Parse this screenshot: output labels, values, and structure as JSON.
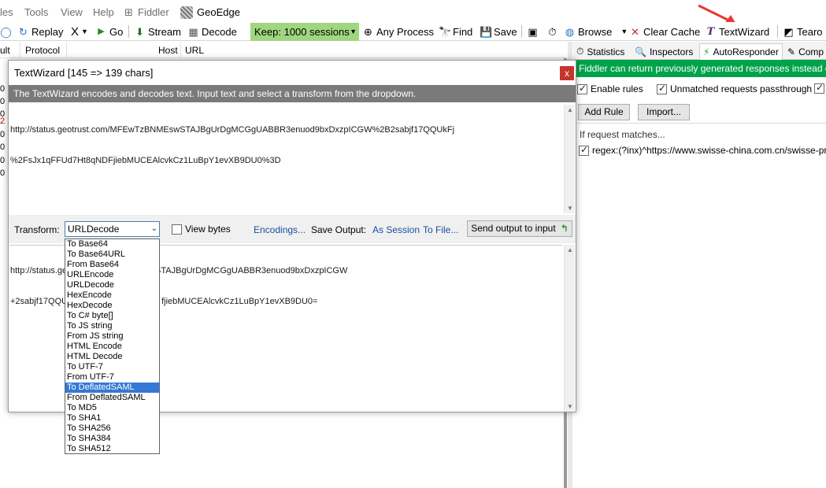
{
  "menu": {
    "items": [
      "les",
      "Tools",
      "View",
      "Help",
      "Fiddler",
      "GeoEdge"
    ]
  },
  "toolbar": {
    "replay": "Replay",
    "remove": "X",
    "go": "Go",
    "stream": "Stream",
    "decode": "Decode",
    "keep": "Keep: 1000 sessions",
    "any_process": "Any Process",
    "find": "Find",
    "save": "Save",
    "browse": "Browse",
    "clear_cache": "Clear Cache",
    "textwizard": "TextWizard",
    "tearoff": "Tearo"
  },
  "grid": {
    "columns": [
      "ult",
      "Protocol",
      "Host",
      "URL"
    ],
    "left_values": [
      "0",
      "0",
      "0",
      "2",
      "0",
      "0",
      "0",
      "0"
    ]
  },
  "right": {
    "tabs": [
      "Statistics",
      "Inspectors",
      "AutoResponder",
      "Comp"
    ],
    "banner": "Fiddler can return previously generated responses instead of u",
    "enable_rules": "Enable rules",
    "unmatched": "Unmatched requests passthrough",
    "add_rule": "Add Rule",
    "import": "Import...",
    "if_request": "If request matches...",
    "rule": "regex:(?inx)^https://www.swisse-china.com.cn/swisse-prefer"
  },
  "textwizard": {
    "title": "TextWizard [145 => 139 chars]",
    "close": "x",
    "description": "The TextWizard encodes and decodes text. Input text and select a transform from the dropdown.",
    "input_line1": "http://status.geotrust.com/MFEwTzBNMEswSTAJBgUrDgMCGgUABBR3enuod9bxDxzpICGW%2B2sabjf17QQUkFj",
    "input_line2": "%2FsJx1qFFUd7Ht8qNDFjiebMUCEAlcvkCz1LuBpY1evXB9DU0%3D",
    "transform_label": "Transform:",
    "transform_value": "URLDecode",
    "view_bytes": "View bytes",
    "encodings": "Encodings...",
    "save_output": "Save Output:",
    "as_session": "As Session",
    "to_file": "To File...",
    "send_output": "Send output to input",
    "output_line1_a": "http://status.ge",
    "output_line1_b": "1EswSTAJBgUrDgMCGgUABBR3enuod9bxDxzpICGW",
    "output_line2_a": "+2sabjf17QQU",
    "output_line2_b": "fjiebMUCEAlcvkCz1LuBpY1evXB9DU0=",
    "options": [
      "To Base64",
      "To Base64URL",
      "From Base64",
      "URLEncode",
      "URLDecode",
      "HexEncode",
      "HexDecode",
      "To C# byte[]",
      "To JS string",
      "From JS string",
      "HTML Encode",
      "HTML Decode",
      "To UTF-7",
      "From UTF-7",
      "To DeflatedSAML",
      "From DeflatedSAML",
      "To MD5",
      "To SHA1",
      "To SHA256",
      "To SHA384",
      "To SHA512"
    ],
    "highlighted_option": "To DeflatedSAML"
  },
  "colors": {
    "keep_bg": "#9fd67f",
    "banner_bg": "#00a34a",
    "desc_bg": "#7a7a7a",
    "close_bg": "#c7352a",
    "link": "#1a4fa0",
    "selection": "#3578d6",
    "annotation_arrow": "#e53a2f"
  }
}
